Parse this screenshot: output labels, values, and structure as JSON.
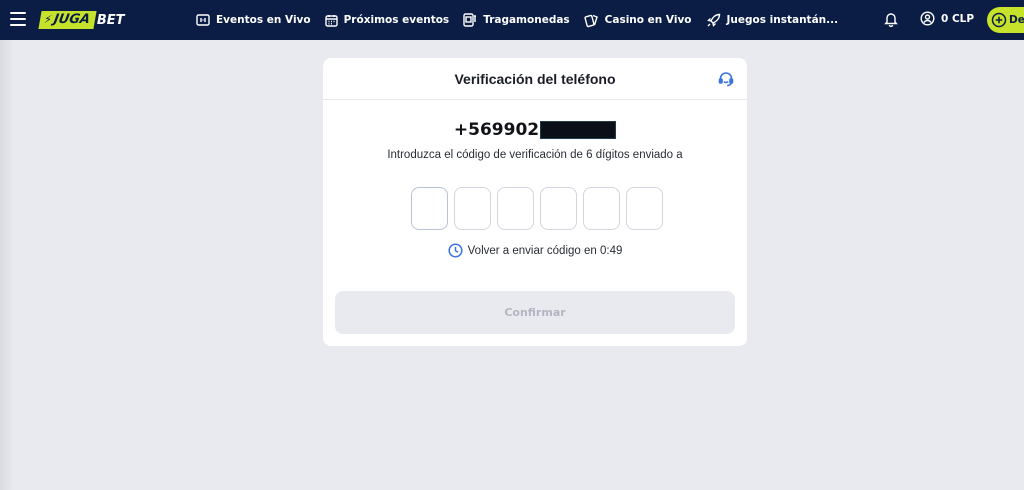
{
  "header": {
    "logo": {
      "juga": "JUGA",
      "bet": "BET"
    },
    "nav": [
      {
        "label": "Eventos en Vivo",
        "icon": "live-scoreboard-icon"
      },
      {
        "label": "Próximos eventos",
        "icon": "calendar-icon"
      },
      {
        "label": "Tragamonedas",
        "icon": "slot-machine-icon"
      },
      {
        "label": "Casino en Vivo",
        "icon": "playing-cards-icon"
      },
      {
        "label": "Juegos instantán...",
        "icon": "rocket-icon"
      }
    ],
    "balance": "0 CLP",
    "deposit_label": "De"
  },
  "verification": {
    "title": "Verificación del teléfono",
    "phone_visible": "+569902",
    "instructions": "Introduzca el código de verificación de 6 dígitos enviado a",
    "code_digits": [
      "",
      "",
      "",
      "",
      "",
      ""
    ],
    "resend_text": "Volver a enviar código en 0:49",
    "confirm_label": "Confirmar"
  },
  "colors": {
    "nav_bg": "#0b1d45",
    "brand_green": "#c6e22b",
    "page_bg": "#e9eaef",
    "accent_blue": "#3b74e0"
  }
}
